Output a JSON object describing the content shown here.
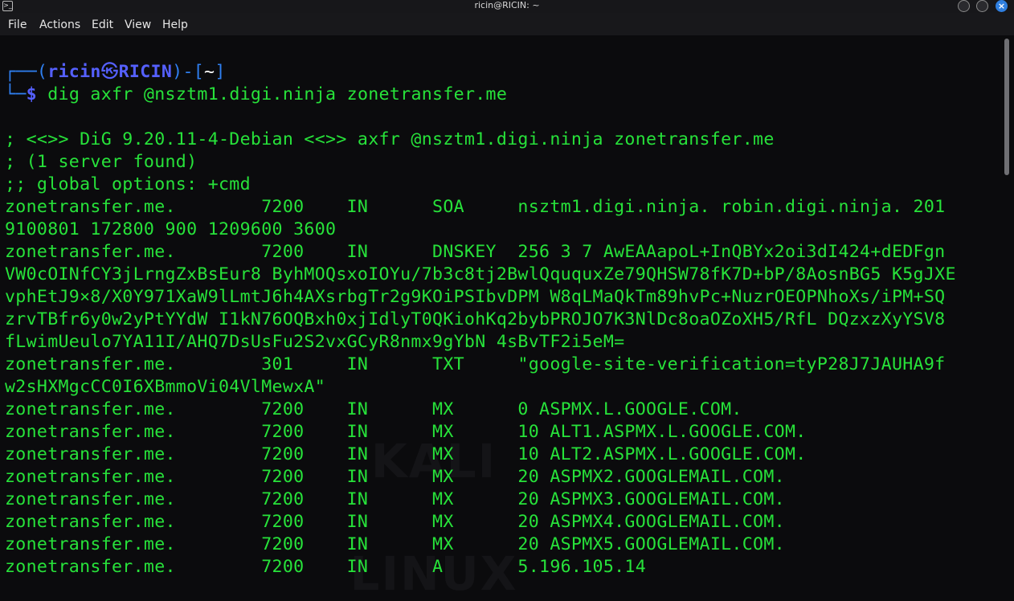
{
  "window": {
    "title": "ricin@RICIN: ~"
  },
  "menu": [
    "File",
    "Actions",
    "Edit",
    "View",
    "Help"
  ],
  "prompt": {
    "open": "┌──(",
    "user": "ricin",
    "at": "㉿",
    "host": "RICIN",
    "mid": ")-[",
    "cwd": "~",
    "close": "]",
    "corner": "└─",
    "dollar": "$",
    "command": " dig axfr @nsztm1.digi.ninja zonetransfer.me"
  },
  "output": [
    "; <<>> DiG 9.20.11-4-Debian <<>> axfr @nsztm1.digi.ninja zonetransfer.me",
    "; (1 server found)",
    ";; global options: +cmd",
    "zonetransfer.me.        7200    IN      SOA     nsztm1.digi.ninja. robin.digi.ninja. 201",
    "9100801 172800 900 1209600 3600",
    "zonetransfer.me.        7200    IN      DNSKEY  256 3 7 AwEAAapoL+InQBYx2oi3dI424+dEDFgn",
    "VW0cOINfCY3jLrngZxBsEur8 ByhMOQsxoIOYu/7b3c8tj2BwlQququxZe79QHSW78fK7D+bP/8AosnBG5 K5gJXE",
    "vphEtJ9×8/X0Y971XaW9lLmtJ6h4AXsrbgTr2g9KOiPSIbvDPM W8qLMaQkTm89hvPc+NuzrOEOPNhoXs/iPM+SQ",
    "zrvTBfr6y0w2yPtYYdW I1kN76OQBxh0xjIdlyT0QKiohKq2bybPROJO7K3NlDc8oaOZoXH5/RfL DQzxzXyYSV8",
    "fLwimUeulo7YA11I/AHQ7DsUsFu2S2vxGCyR8nmx9gYbN 4sBvTF2i5eM=",
    "zonetransfer.me.        301     IN      TXT     \"google-site-verification=tyP28J7JAUHA9f",
    "w2sHXMgcCC0I6XBmmoVi04VlMewxA\"",
    "zonetransfer.me.        7200    IN      MX      0 ASPMX.L.GOOGLE.COM.",
    "zonetransfer.me.        7200    IN      MX      10 ALT1.ASPMX.L.GOOGLE.COM.",
    "zonetransfer.me.        7200    IN      MX      10 ALT2.ASPMX.L.GOOGLE.COM.",
    "zonetransfer.me.        7200    IN      MX      20 ASPMX2.GOOGLEMAIL.COM.",
    "zonetransfer.me.        7200    IN      MX      20 ASPMX3.GOOGLEMAIL.COM.",
    "zonetransfer.me.        7200    IN      MX      20 ASPMX4.GOOGLEMAIL.COM.",
    "zonetransfer.me.        7200    IN      MX      20 ASPMX5.GOOGLEMAIL.COM.",
    "zonetransfer.me.        7200    IN      A       5.196.105.14"
  ],
  "colors": {
    "output_text": "#27e23a",
    "prompt_frame": "#2f7ff0",
    "prompt_user": "#5560ff",
    "background": "#0b0b0d"
  }
}
